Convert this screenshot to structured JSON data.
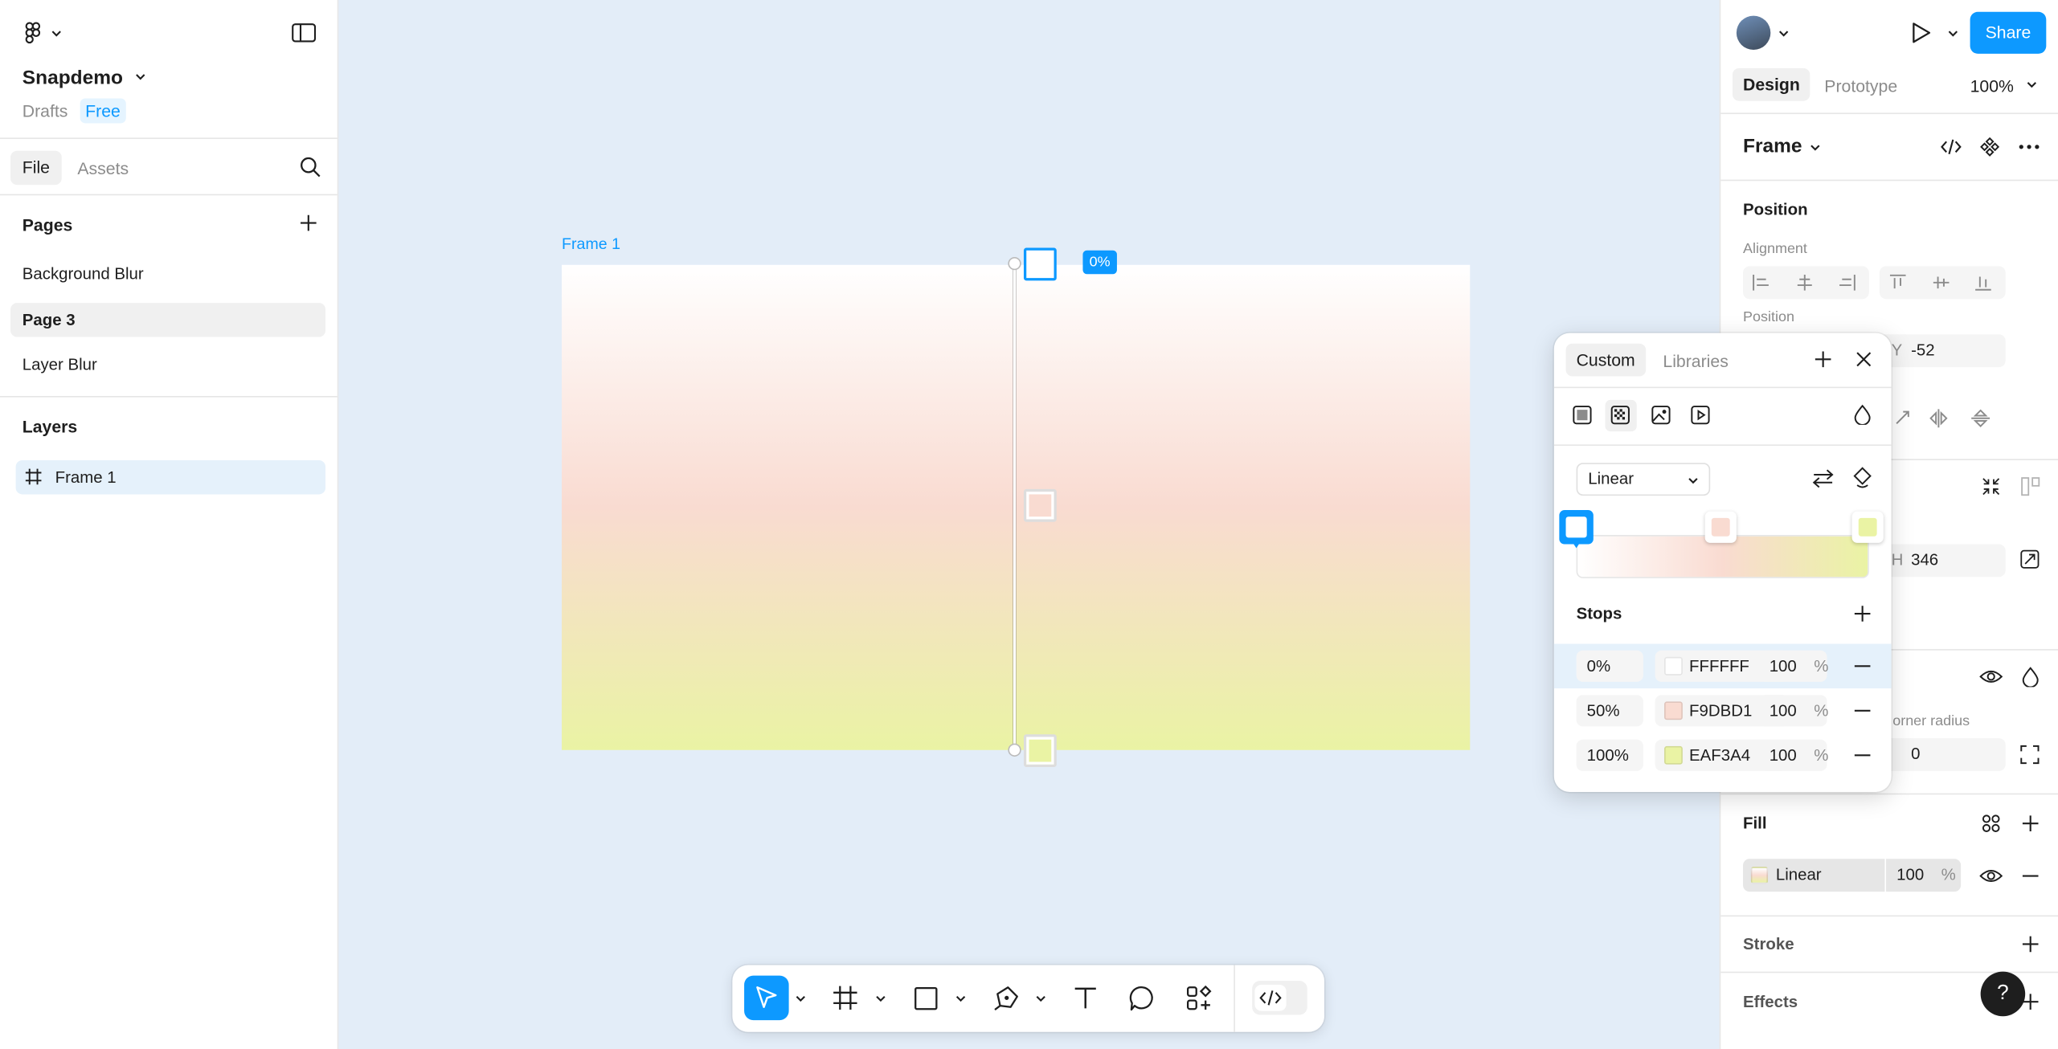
{
  "app": {
    "file_name": "Snapdemo",
    "drafts_label": "Drafts",
    "plan_badge": "Free"
  },
  "left_tabs": {
    "file": "File",
    "assets": "Assets"
  },
  "pages": {
    "heading": "Pages",
    "items": [
      "Background Blur",
      "Page 3",
      "Layer Blur"
    ],
    "selected": "Page 3"
  },
  "layers": {
    "heading": "Layers",
    "items": [
      "Frame 1"
    ]
  },
  "canvas": {
    "frame_label": "Frame 1",
    "gradient_stops": [
      "#FFFFFF",
      "#F9DBD1",
      "#EAF3A4"
    ],
    "handle_badge": "0%"
  },
  "right_panel": {
    "share_label": "Share",
    "tabs": {
      "design": "Design",
      "prototype": "Prototype"
    },
    "zoom": "100%",
    "selection_type": "Frame",
    "position_heading": "Position",
    "alignment_label": "Alignment",
    "position_label": "Position",
    "y_label": "Y",
    "y_value": "-52",
    "h_label": "H",
    "h_value": "346",
    "corner_radius_label": "orner radius",
    "corner_radius_value": "0",
    "fill_heading": "Fill",
    "fill_type": "Linear",
    "fill_opacity": "100",
    "percent": "%",
    "stroke_heading": "Stroke",
    "effects_heading": "Effects",
    "help": "?"
  },
  "color_popup": {
    "tabs": {
      "custom": "Custom",
      "libraries": "Libraries"
    },
    "gradient_type": "Linear",
    "stops_heading": "Stops",
    "stops": [
      {
        "position": "0%",
        "hex": "FFFFFF",
        "opacity": "100",
        "color": "#FFFFFF"
      },
      {
        "position": "50%",
        "hex": "F9DBD1",
        "opacity": "100",
        "color": "#F9DBD1"
      },
      {
        "position": "100%",
        "hex": "EAF3A4",
        "opacity": "100",
        "color": "#EAF3A4"
      }
    ],
    "percent": "%"
  },
  "colors": {
    "accent": "#0d99ff",
    "canvas_bg": "#e3edf8",
    "selected_layer_bg": "#e5f1fb"
  }
}
